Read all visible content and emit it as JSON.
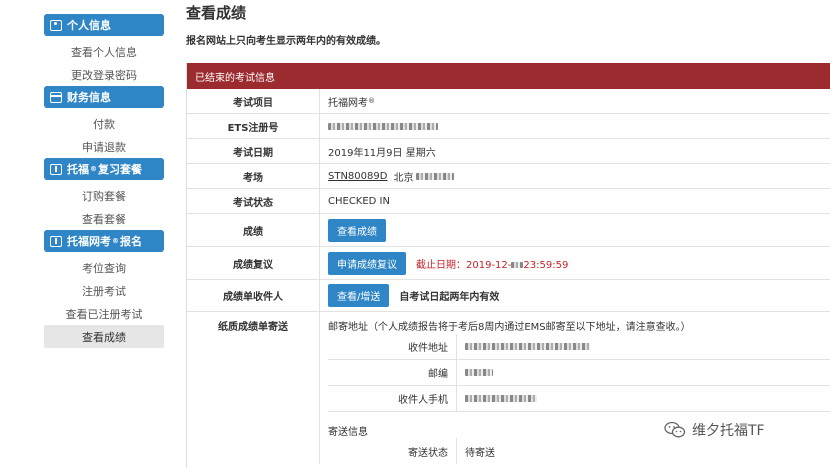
{
  "sidebar": {
    "personal": {
      "header": "个人信息",
      "items": [
        "查看个人信息",
        "更改登录密码"
      ]
    },
    "finance": {
      "header": "财务信息",
      "items": [
        "付款",
        "申请退款"
      ]
    },
    "review": {
      "header_pre": "托福",
      "header_sup": "®",
      "header_post": "复习套餐",
      "items": [
        "订购套餐",
        "查看套餐"
      ]
    },
    "ibt": {
      "header_pre": "托福网考",
      "header_sup": "®",
      "header_post": "报名",
      "items": [
        "考位查询",
        "注册考试",
        "查看已注册考试",
        "查看成绩"
      ]
    }
  },
  "main": {
    "title": "查看成绩",
    "subtitle": "报名网站上只向考生显示两年内的有效成绩。",
    "panel_header": "已结束的考试信息",
    "rows": {
      "test_item": {
        "label": "考试项目",
        "value": "托福网考",
        "sup": "®"
      },
      "ets_id": {
        "label": "ETS注册号"
      },
      "test_date": {
        "label": "考试日期",
        "value": "2019年11月9日 星期六"
      },
      "center": {
        "label": "考场",
        "code": "STN80089D",
        "city": "北京"
      },
      "status": {
        "label": "考试状态",
        "value": "CHECKED IN"
      },
      "score": {
        "label": "成绩",
        "button": "查看成绩"
      },
      "review": {
        "label": "成绩复议",
        "button": "申请成绩复议",
        "deadline_label": "截止日期：",
        "deadline_pre": "2019-12-",
        "deadline_post": "23:59:59"
      },
      "recipients": {
        "label": "成绩单收件人",
        "button": "查看/增送",
        "note": "自考试日起两年内有效"
      },
      "paper": {
        "label": "纸质成绩单寄送",
        "intro": "邮寄地址（个人成绩报告将于考后8周内通过EMS邮寄至以下地址，请注意查收。）",
        "address_label": "收件地址",
        "zip_label": "邮编",
        "phone_label": "收件人手机",
        "shipping_info": "寄送信息",
        "ship_status_label": "寄送状态",
        "ship_status_value": "待寄送"
      }
    }
  },
  "watermark": {
    "text": "维夕托福TF"
  },
  "colors": {
    "accent": "#2f86c6",
    "panel_header": "#9c2b2f",
    "deadline": "#c4242b"
  }
}
